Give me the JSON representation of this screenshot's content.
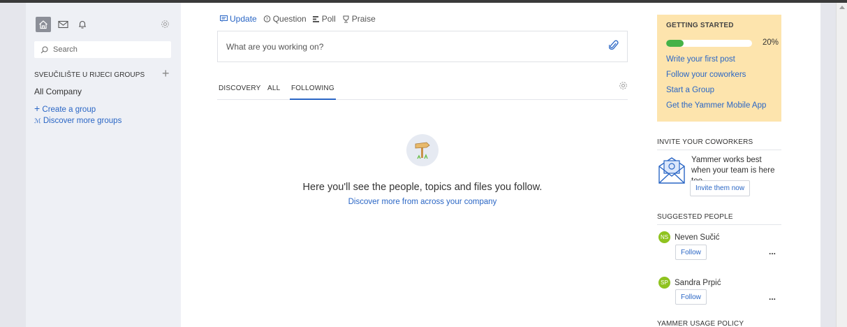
{
  "nav": {
    "icons": [
      "home-icon",
      "mail-icon",
      "bell-icon"
    ],
    "settings_icon": "gear-icon"
  },
  "sidebar": {
    "search_placeholder": "Search",
    "groups_header": "SVEUČILIŠTE U RIJECI GROUPS",
    "groups": [
      "All Company"
    ],
    "create_group": "Create a group",
    "discover_groups": "Discover more groups"
  },
  "publisher": {
    "tabs": [
      {
        "label": "Update",
        "icon": "update-icon"
      },
      {
        "label": "Question",
        "icon": "question-icon"
      },
      {
        "label": "Poll",
        "icon": "poll-icon"
      },
      {
        "label": "Praise",
        "icon": "praise-icon"
      }
    ],
    "placeholder": "What are you working on?"
  },
  "feed": {
    "tabs": [
      "DISCOVERY",
      "ALL",
      "FOLLOWING"
    ],
    "active_tab": "FOLLOWING",
    "empty_title": "Here you'll see the people, topics and files you follow.",
    "empty_link": "Discover more from across your company"
  },
  "getting_started": {
    "title": "GETTING STARTED",
    "progress": 0.2,
    "progress_label": "20%",
    "links": [
      "Write your first post",
      "Follow your coworkers",
      "Start a Group",
      "Get the Yammer Mobile App"
    ]
  },
  "invite": {
    "title": "INVITE YOUR COWORKERS",
    "text": "Yammer works best when your team is here too.",
    "button": "Invite them now"
  },
  "suggested": {
    "title": "SUGGESTED PEOPLE",
    "people": [
      {
        "initials": "NS",
        "name": "Neven Sučić",
        "button": "Follow",
        "more": "..."
      },
      {
        "initials": "SP",
        "name": "Sandra Prpić",
        "button": "Follow",
        "more": "..."
      }
    ]
  },
  "policy_title": "YAMMER USAGE POLICY",
  "colors": {
    "accent": "#2a66c5",
    "sidebar_bg": "#eef0f5",
    "getting_started_bg": "#fde4ad",
    "progress": "#45b247",
    "avatar": "#8fc31f"
  }
}
